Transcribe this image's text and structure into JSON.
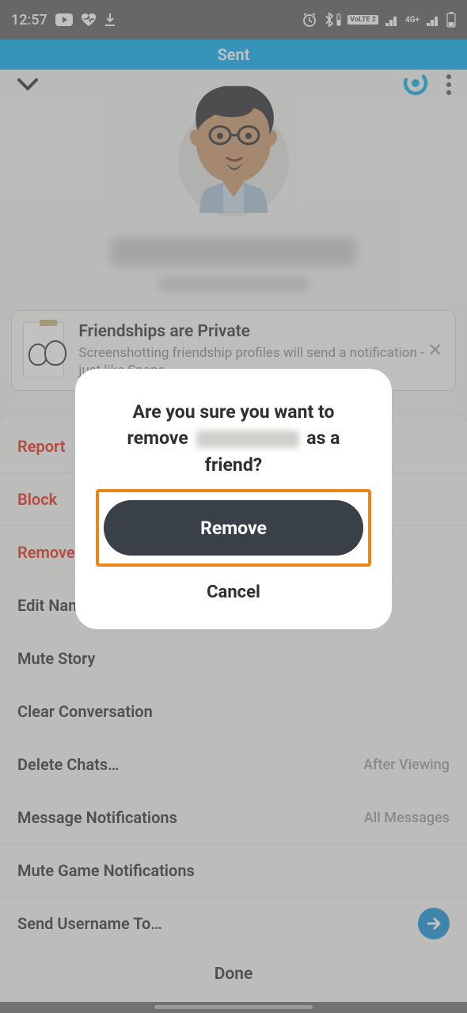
{
  "status": {
    "time": "12:57",
    "volte": "VoLTE 2",
    "net": "4G+"
  },
  "banner": {
    "text": "Sent"
  },
  "info_card": {
    "title": "Friendships are Private",
    "body": "Screenshotting friendship profiles will send a notification - just like Snaps"
  },
  "options": {
    "report": "Report",
    "block": "Block",
    "remove": "Remove",
    "edit_name": "Edit Name",
    "mute_story": "Mute Story",
    "clear_convo": "Clear Conversation",
    "delete_chats": "Delete Chats…",
    "delete_chats_meta": "After Viewing",
    "msg_notif": "Message Notifications",
    "msg_notif_meta": "All Messages",
    "mute_game": "Mute Game Notifications",
    "send_username": "Send Username To…",
    "done": "Done"
  },
  "dialog": {
    "line1": "Are you sure you want to",
    "line2a": "remove",
    "line2b": "as a",
    "line3": "friend?",
    "remove": "Remove",
    "cancel": "Cancel"
  }
}
